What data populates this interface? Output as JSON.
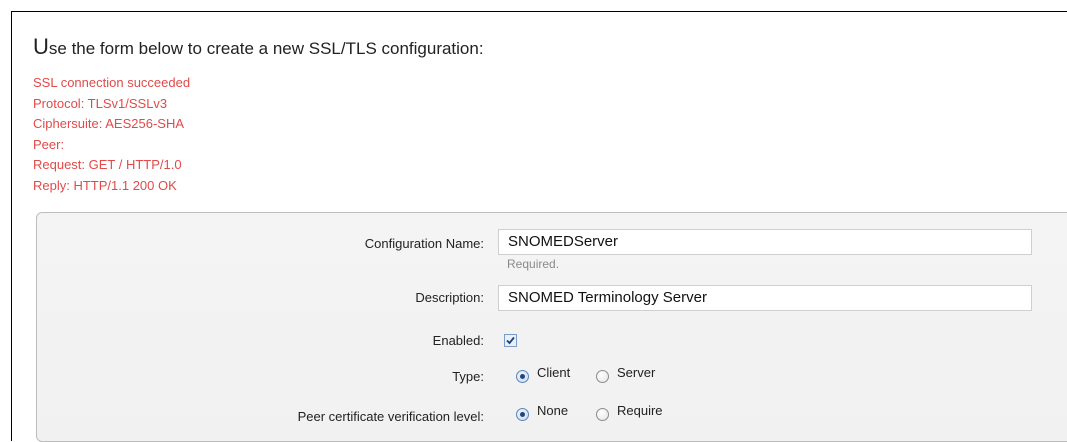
{
  "intro": {
    "first_letter": "U",
    "rest": "se the form below to create a new SSL/TLS configuration:"
  },
  "status_lines": [
    "SSL connection succeeded",
    "Protocol: TLSv1/SSLv3",
    "Ciphersuite: AES256-SHA",
    "Peer:",
    "Request: GET / HTTP/1.0",
    "Reply: HTTP/1.1 200 OK"
  ],
  "form": {
    "config_name": {
      "label": "Configuration Name:",
      "value": "SNOMEDServer",
      "hint": "Required."
    },
    "description": {
      "label": "Description:",
      "value": "SNOMED Terminology Server"
    },
    "enabled": {
      "label": "Enabled:",
      "checked": true
    },
    "type": {
      "label": "Type:",
      "options": [
        "Client",
        "Server"
      ],
      "selected": "Client"
    },
    "peer_verification": {
      "label": "Peer certificate verification level:",
      "options": [
        "None",
        "Require"
      ],
      "selected": "None"
    }
  },
  "colors": {
    "status_text": "#e24a4a",
    "panel_bg": "#f3f3f3",
    "panel_border": "#bdbdbd"
  }
}
